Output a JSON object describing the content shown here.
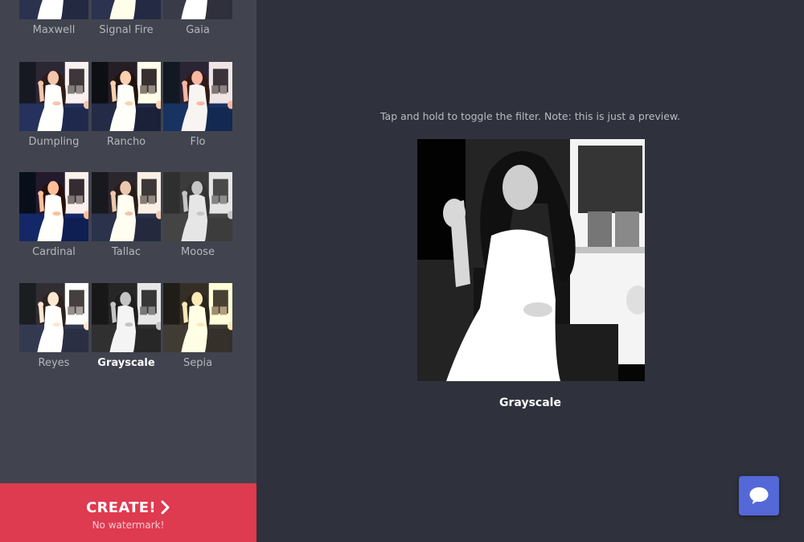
{
  "sidebar": {
    "filters": [
      {
        "label": "Maxwell"
      },
      {
        "label": "Signal Fire"
      },
      {
        "label": "Gaia"
      },
      {
        "label": "Dumpling"
      },
      {
        "label": "Rancho"
      },
      {
        "label": "Flo"
      },
      {
        "label": "Cardinal"
      },
      {
        "label": "Tallac"
      },
      {
        "label": "Moose"
      },
      {
        "label": "Reyes"
      },
      {
        "label": "Grayscale"
      },
      {
        "label": "Sepia"
      }
    ],
    "selected_filter": "Grayscale",
    "create": {
      "label": "CREATE!",
      "sublabel": "No watermark!"
    }
  },
  "main": {
    "hint": "Tap and hold to toggle the filter. Note: this is just a preview.",
    "preview_filter_name": "Grayscale"
  },
  "icons": {
    "create_chevron": "chevron-right-icon",
    "chat": "chat-bubble-icon"
  },
  "colors": {
    "sidebar_bg": "#41444e",
    "main_bg": "#2f323c",
    "create_button": "#de3a50",
    "chat_button": "#5468d8"
  }
}
